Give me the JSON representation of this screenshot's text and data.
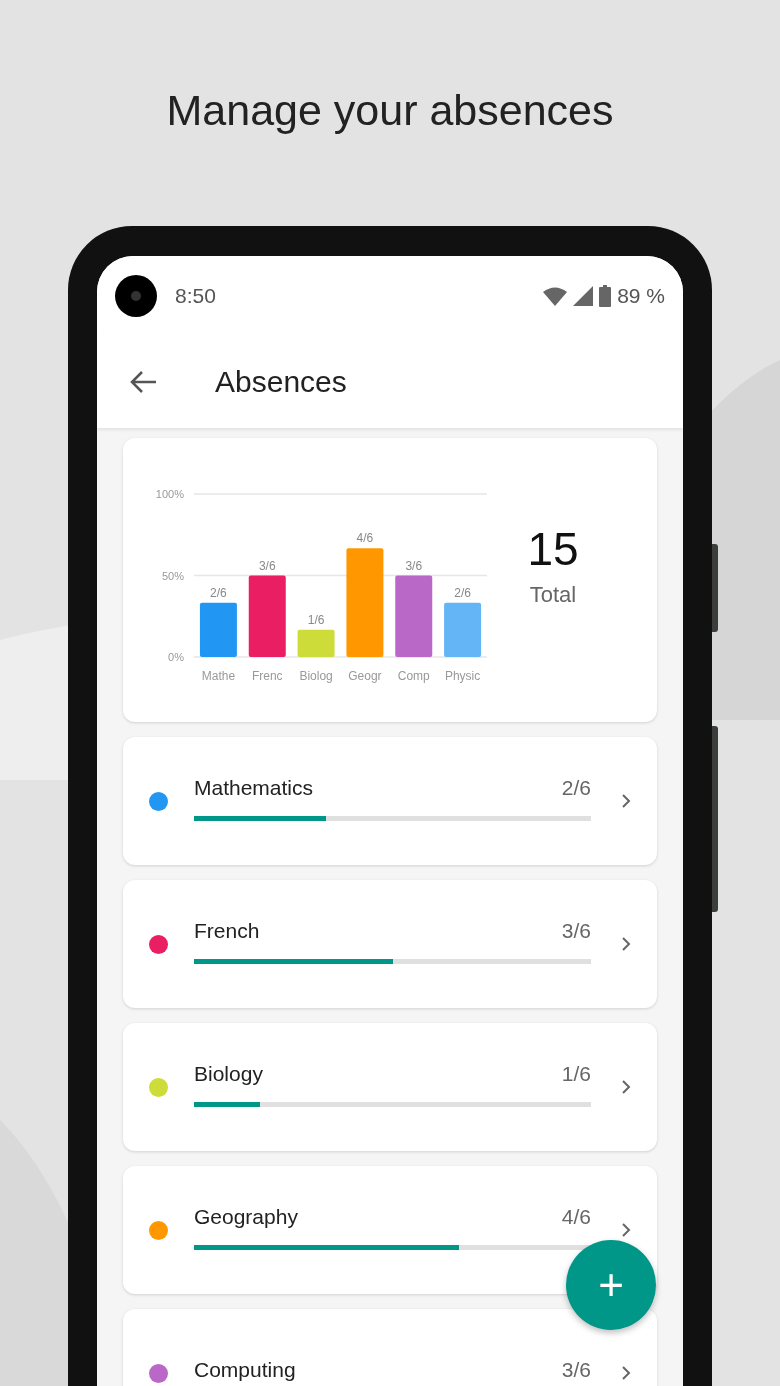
{
  "headline": "Manage your absences",
  "status_bar": {
    "time": "8:50",
    "battery": "89 %"
  },
  "app_bar": {
    "title": "Absences"
  },
  "summary": {
    "total": "15",
    "total_label": "Total",
    "chart_data": {
      "type": "bar",
      "categories": [
        "Mathe",
        "Frenc",
        "Biolog",
        "Geogr",
        "Comp",
        "Physic"
      ],
      "series": [
        {
          "colors": [
            "#2196f3",
            "#e91e63",
            "#cddc39",
            "#ff9800",
            "#ba68c8",
            "#64b5f6"
          ],
          "values": [
            33.3,
            50,
            16.7,
            66.7,
            50,
            33.3
          ]
        }
      ],
      "ylim": [
        0,
        100
      ],
      "yticks": [
        {
          "value": 0,
          "label": "0%"
        },
        {
          "value": 50,
          "label": "50%"
        },
        {
          "value": 100,
          "label": "100%"
        }
      ],
      "value_labels": [
        "2/6",
        "3/6",
        "1/6",
        "4/6",
        "3/6",
        "2/6"
      ]
    }
  },
  "subjects": [
    {
      "name": "Mathematics",
      "count": "2/6",
      "color": "#2196f3",
      "level": 0.333
    },
    {
      "name": "French",
      "count": "3/6",
      "color": "#e91e63",
      "level": 0.5
    },
    {
      "name": "Biology",
      "count": "1/6",
      "color": "#cddc39",
      "level": 0.167
    },
    {
      "name": "Geography",
      "count": "4/6",
      "color": "#ff9800",
      "level": 0.667
    },
    {
      "name": "Computing",
      "count": "3/6",
      "color": "#ba68c8"
    }
  ],
  "fab": {
    "label": "+"
  }
}
